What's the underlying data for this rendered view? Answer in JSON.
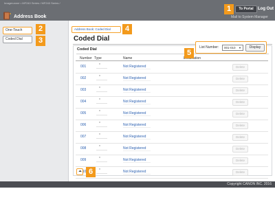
{
  "header": {
    "breadcrumb_top": "Imagerunner • MF240 Series / MF240 Series /",
    "app_title": "Address Book",
    "to_portal": "To Portal",
    "logout": "Log Out",
    "mail_to": "Mail to System Manager"
  },
  "sidebar": {
    "items": [
      {
        "label": "One-Touch"
      },
      {
        "label": "Coded Dial"
      }
    ]
  },
  "main": {
    "breadcrumb": "Address Book: Coded Dial",
    "page_title": "Coded Dial",
    "panel_title": "Coded Dial",
    "list_number_label": "List Number:",
    "list_number_value": "001-010",
    "display_label": "Display",
    "columns": {
      "number": "Number",
      "type": "Type",
      "name": "Name",
      "destination": "Destination"
    },
    "rows": [
      {
        "number": "001",
        "type": "*",
        "name": "Not Registered",
        "action": "Delete"
      },
      {
        "number": "002",
        "type": "*",
        "name": "Not Registered",
        "action": "Delete"
      },
      {
        "number": "003",
        "type": "*",
        "name": "Not Registered",
        "action": "Delete"
      },
      {
        "number": "004",
        "type": "*",
        "name": "Not Registered",
        "action": "Delete"
      },
      {
        "number": "005",
        "type": "*",
        "name": "Not Registered",
        "action": "Delete"
      },
      {
        "number": "006",
        "type": "*",
        "name": "Not Registered",
        "action": "Delete"
      },
      {
        "number": "007",
        "type": "*",
        "name": "Not Registered",
        "action": "Delete"
      },
      {
        "number": "008",
        "type": "*",
        "name": "Not Registered",
        "action": "Delete"
      },
      {
        "number": "009",
        "type": "*",
        "name": "Not Registered",
        "action": "Delete"
      },
      {
        "number": "010",
        "type": "*",
        "name": "Not Registered",
        "action": "Delete"
      }
    ]
  },
  "footer": {
    "copyright": "Copyright CANON INC. 2016"
  },
  "callouts": [
    "1",
    "2",
    "3",
    "4",
    "5",
    "6"
  ],
  "colors": {
    "callout": "#f39a1c",
    "header": "#6b6e73",
    "link": "#2a5fb0"
  }
}
